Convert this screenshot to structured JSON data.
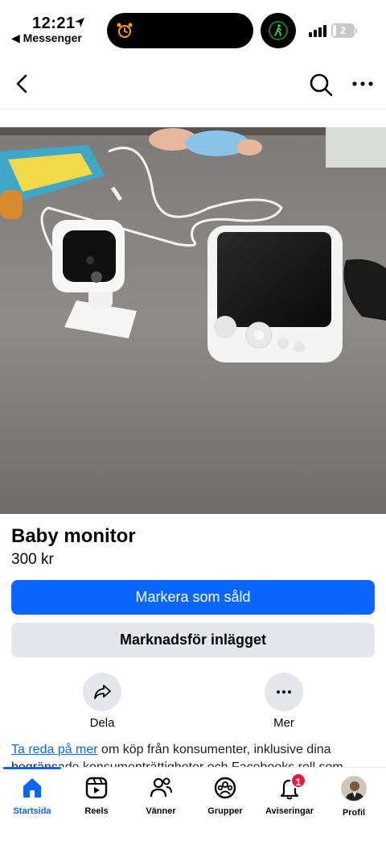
{
  "status_bar": {
    "time": "12:21",
    "back_app": "◀ Messenger",
    "battery": "2"
  },
  "listing": {
    "title": "Baby monitor",
    "price": "300 kr"
  },
  "buttons": {
    "mark_sold": "Markera som såld",
    "promote": "Marknadsför inlägget"
  },
  "actions": {
    "share": "Dela",
    "more": "Mer"
  },
  "info": {
    "link": "Ta reda på mer",
    "text": " om köp från konsumenter, inklusive dina begränsade konsumenträttigheter och Facebooks roll som"
  },
  "tabs": [
    {
      "label": "Startsida",
      "icon": "home-icon",
      "active": true
    },
    {
      "label": "Reels",
      "icon": "reels-icon"
    },
    {
      "label": "Vänner",
      "icon": "friends-icon"
    },
    {
      "label": "Grupper",
      "icon": "groups-icon"
    },
    {
      "label": "Aviseringar",
      "icon": "bell-icon",
      "badge": "1"
    },
    {
      "label": "Profil",
      "icon": "profile-avatar"
    }
  ],
  "colors": {
    "primary": "#0866ff",
    "secondary_bg": "#e4e6eb",
    "badge": "#e41e3f"
  }
}
